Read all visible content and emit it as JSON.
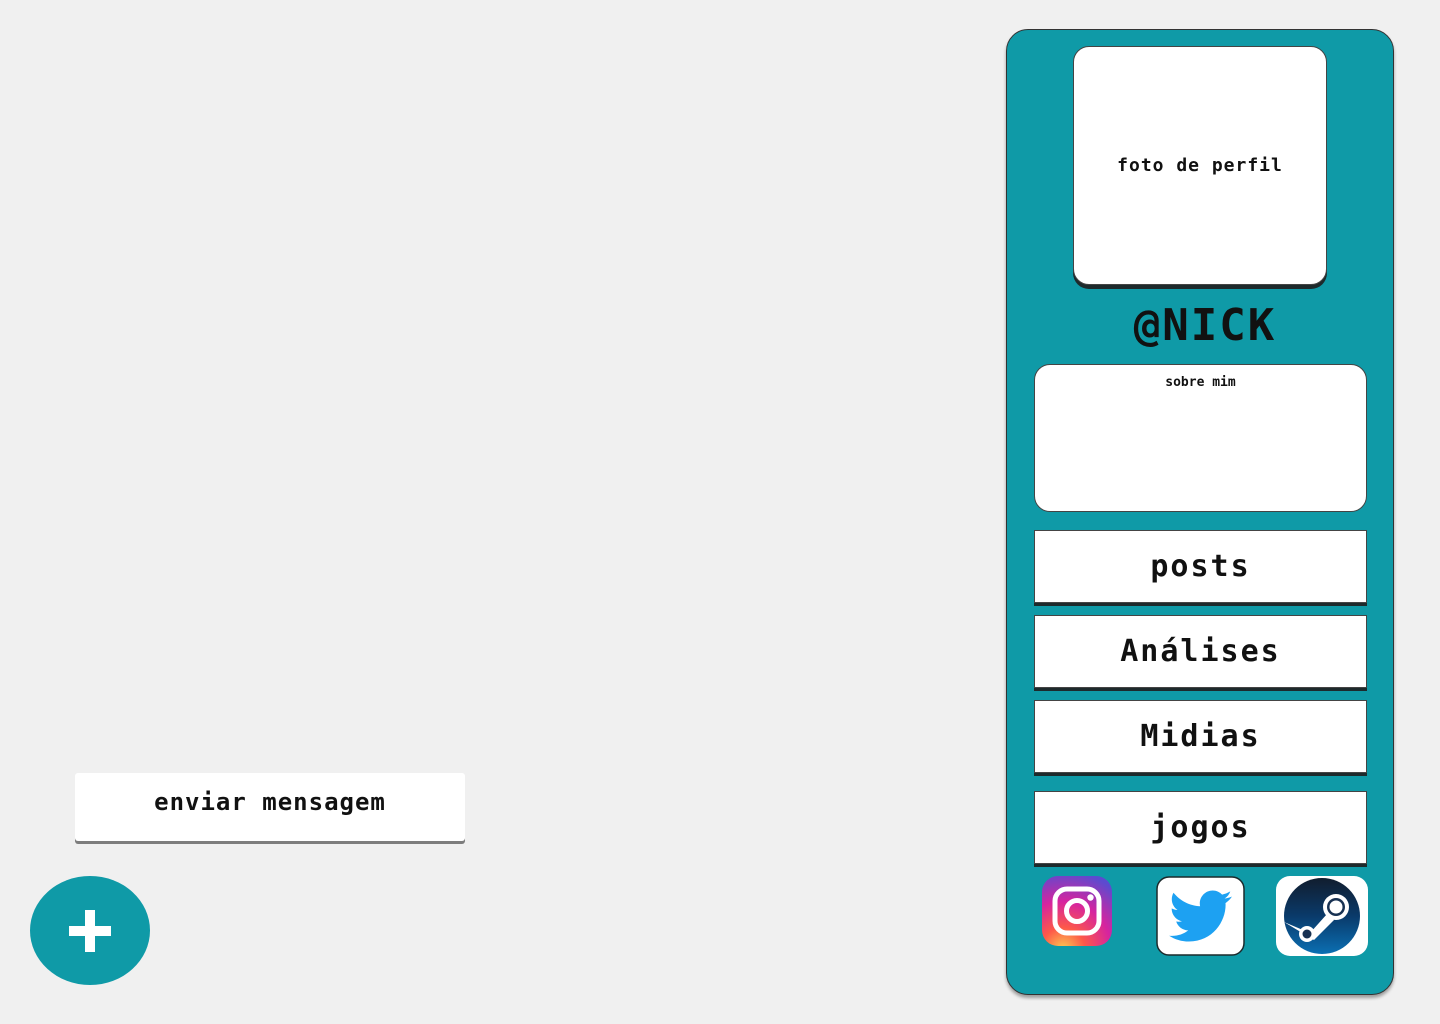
{
  "send_message": {
    "label": "enviar mensagem"
  },
  "fab": {
    "icon": "plus-icon",
    "color": "#0f9aa7"
  },
  "profile": {
    "photo_placeholder": "foto de perfil",
    "nick": "@NICK",
    "about_label": "sobre mim",
    "panel_color": "#0f9aa7"
  },
  "nav": {
    "posts": "posts",
    "reviews": "Análises",
    "media": "Midias",
    "games": "jogos"
  },
  "social": [
    {
      "name": "instagram",
      "icon": "instagram-icon"
    },
    {
      "name": "twitter",
      "icon": "twitter-icon",
      "color": "#1da1f2"
    },
    {
      "name": "steam",
      "icon": "steam-icon"
    }
  ]
}
